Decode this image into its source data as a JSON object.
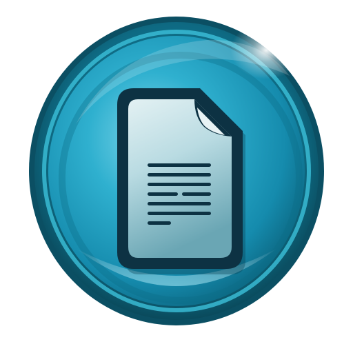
{
  "icon": {
    "name": "document-icon",
    "shape": "glossy-circle-button",
    "colors": {
      "outer_ring": "#0b4f63",
      "rim_light": "#27a9c5",
      "face_center": "#6fd0e6",
      "face_mid": "#1e9cbb",
      "face_edge": "#0a5f78",
      "document_outline": "#0d3243",
      "document_paper_light": "#d9ecef",
      "document_paper_dark": "#7fb2be",
      "text_lines": "#0d3243",
      "highlight": "#ffffff"
    }
  }
}
